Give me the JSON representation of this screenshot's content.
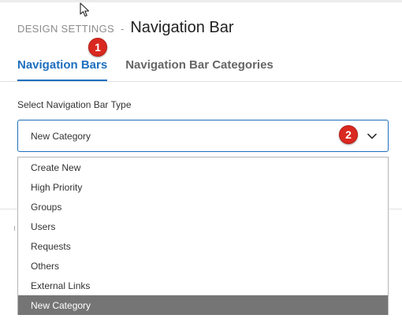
{
  "header": {
    "breadcrumb": "DESIGN SETTINGS",
    "separator": "-",
    "title": "Navigation Bar"
  },
  "annotations": {
    "badge_1": "1",
    "badge_2": "2"
  },
  "tabs": [
    {
      "label": "Navigation Bars",
      "active": true
    },
    {
      "label": "Navigation Bar Categories",
      "active": false
    }
  ],
  "form": {
    "label": "Select Navigation Bar Type",
    "selected_value": "New Category"
  },
  "dropdown": {
    "options": [
      "Create New",
      "High Priority",
      "Groups",
      "Users",
      "Requests",
      "Others",
      "External Links",
      "New Category"
    ],
    "selected_index": 7
  },
  "colors": {
    "accent": "#1e6fbf",
    "badge": "#d9281f",
    "selected_option_bg": "#757575"
  },
  "icons": {
    "cursor": "mouse-pointer-icon",
    "chevron": "chevron-down-icon"
  }
}
